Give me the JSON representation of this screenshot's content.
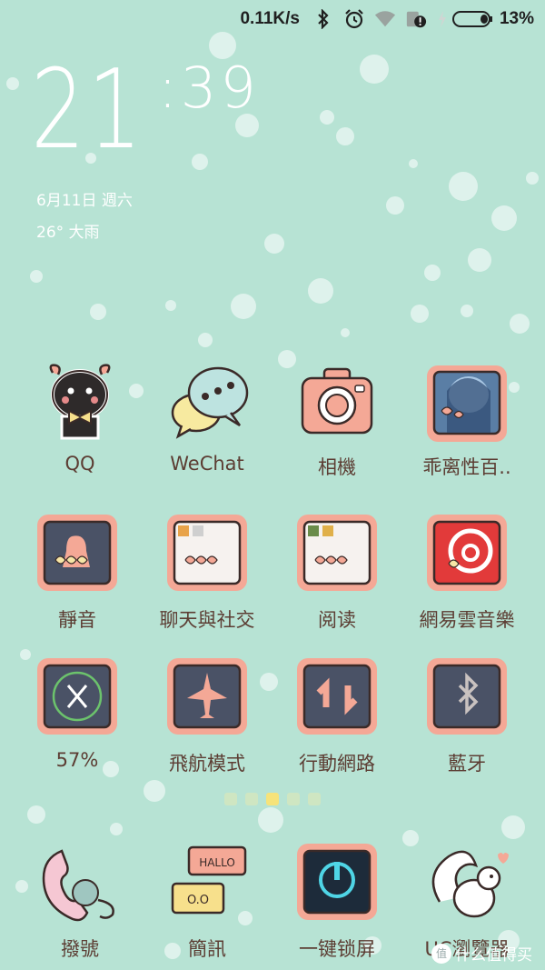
{
  "status_bar": {
    "net_speed": "0.11K/s",
    "battery": "13%"
  },
  "clock": {
    "hours": "21",
    "minutes": ":39"
  },
  "date": "6月11日 週六",
  "weather": "26° 大雨",
  "apps": [
    {
      "label": "QQ"
    },
    {
      "label": "WeChat"
    },
    {
      "label": "相機"
    },
    {
      "label": "乖离性百.."
    },
    {
      "label": "靜音"
    },
    {
      "label": "聊天與社交"
    },
    {
      "label": "阅读"
    },
    {
      "label": "網易雲音樂"
    },
    {
      "label": "57%"
    },
    {
      "label": "飛航模式"
    },
    {
      "label": "行動網路"
    },
    {
      "label": "藍牙"
    }
  ],
  "dock": [
    {
      "label": "撥號"
    },
    {
      "label": "簡訊"
    },
    {
      "label": "一键锁屏"
    },
    {
      "label": "UC瀏覽器"
    }
  ],
  "page_indicator": {
    "count": 5,
    "active": 3
  },
  "watermark": "什么值得买",
  "colors": {
    "background": "#b7e3d4",
    "frame": "#f4a896",
    "tile": "#4a5266",
    "accent": "#ffffff"
  }
}
